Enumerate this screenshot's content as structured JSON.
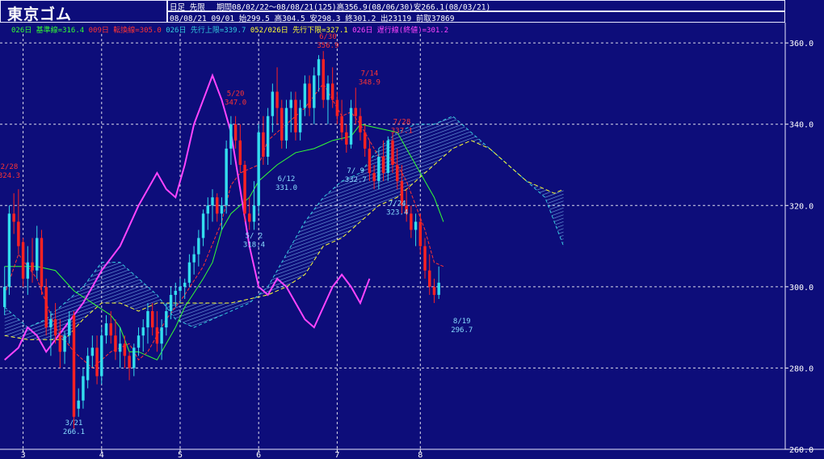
{
  "header": {
    "title": "東京ゴム",
    "line1_a": "日足 先限",
    "line1_b": "期間08/02/22～08/08/21(125)高356.9(08/06/30)安266.1(08/03/21)",
    "line2": "08/08/21 09/01 始299.5 高304.5 安298.3 終301.2 出23119 前取37869"
  },
  "legend": [
    {
      "text": "026日 基準線=316.4",
      "color": "#33ff33"
    },
    {
      "text": "009日 転換線=305.0",
      "color": "#ff3333"
    },
    {
      "text": "026日 先行上限=339.7",
      "color": "#33ccdd"
    },
    {
      "text": "052/026日 先行下限=327.1",
      "color": "#ffff33"
    },
    {
      "text": "026日 遅行線(終値)=301.2",
      "color": "#ff44ff"
    }
  ],
  "colors": {
    "background": "#0d0d7a",
    "grid": "#ffffff",
    "up_candle": "#33ddee",
    "down_candle": "#ff2222",
    "kijun": "#33ff33",
    "tenkan": "#ff3333",
    "senkou_a": "#33ccdd",
    "senkou_b": "#ffff33",
    "chikou": "#ff44ff",
    "axis_text": "#ffffff",
    "label_high": "#ff3333",
    "label_low": "#88ddff"
  },
  "chart_data": {
    "type": "candlestick",
    "ylim": [
      260,
      365
    ],
    "yticks": [
      260,
      280,
      300,
      320,
      340,
      360
    ],
    "ytick_labels": [
      "260.0",
      "280.0",
      "300.0",
      "320.0",
      "340.0",
      "360.0"
    ],
    "xlim": [
      0,
      170
    ],
    "month_ticks": [
      {
        "x": 5,
        "label": "3"
      },
      {
        "x": 22,
        "label": "4"
      },
      {
        "x": 39,
        "label": "5"
      },
      {
        "x": 56,
        "label": "6"
      },
      {
        "x": 73,
        "label": "7"
      },
      {
        "x": 91,
        "label": "8"
      }
    ],
    "candles": [
      [
        1,
        295,
        305,
        293,
        300
      ],
      [
        2,
        300,
        320,
        298,
        318
      ],
      [
        3,
        318,
        323,
        313,
        316
      ],
      [
        4,
        316,
        324,
        308,
        310
      ],
      [
        5,
        311,
        312,
        300,
        302
      ],
      [
        6,
        302,
        310,
        298,
        306
      ],
      [
        7,
        306,
        312,
        301,
        304
      ],
      [
        8,
        304,
        315,
        302,
        312
      ],
      [
        9,
        312,
        314,
        298,
        300
      ],
      [
        10,
        300,
        302,
        288,
        290
      ],
      [
        11,
        290,
        294,
        283,
        292
      ],
      [
        12,
        292,
        296,
        286,
        288
      ],
      [
        13,
        288,
        292,
        280,
        284
      ],
      [
        14,
        284,
        289,
        281,
        288
      ],
      [
        15,
        288,
        294,
        286,
        292
      ],
      [
        16,
        293,
        294,
        265,
        268
      ],
      [
        17,
        270,
        275,
        268,
        272
      ],
      [
        18,
        272,
        280,
        270,
        278
      ],
      [
        19,
        277,
        285,
        275,
        283
      ],
      [
        20,
        283,
        288,
        280,
        285
      ],
      [
        21,
        285,
        288,
        276,
        278
      ],
      [
        22,
        278,
        290,
        276,
        288
      ],
      [
        23,
        288,
        293,
        286,
        291
      ],
      [
        24,
        291,
        294,
        286,
        288
      ],
      [
        25,
        288,
        292,
        282,
        284
      ],
      [
        26,
        284,
        290,
        280,
        286
      ],
      [
        27,
        286,
        288,
        280,
        283
      ],
      [
        28,
        283,
        284,
        277,
        280
      ],
      [
        29,
        280,
        286,
        278,
        285
      ],
      [
        30,
        285,
        290,
        283,
        288
      ],
      [
        31,
        288,
        292,
        284,
        290
      ],
      [
        32,
        290,
        296,
        286,
        294
      ],
      [
        33,
        294,
        296,
        288,
        290
      ],
      [
        34,
        290,
        294,
        284,
        286
      ],
      [
        35,
        286,
        292,
        282,
        290
      ],
      [
        36,
        290,
        296,
        288,
        294
      ],
      [
        37,
        294,
        300,
        292,
        298
      ],
      [
        38,
        298,
        301,
        295,
        299
      ],
      [
        39,
        299,
        302,
        296,
        300
      ],
      [
        40,
        300,
        302,
        297,
        301
      ],
      [
        41,
        301,
        308,
        300,
        306
      ],
      [
        42,
        306,
        310,
        303,
        308
      ],
      [
        43,
        308,
        314,
        305,
        312
      ],
      [
        44,
        312,
        319,
        310,
        318
      ],
      [
        45,
        318,
        322,
        314,
        320
      ],
      [
        46,
        320,
        324,
        316,
        322
      ],
      [
        47,
        322,
        323,
        316,
        318
      ],
      [
        48,
        318,
        322,
        314,
        320
      ],
      [
        49,
        320,
        336,
        318,
        334
      ],
      [
        50,
        334,
        342,
        330,
        340
      ],
      [
        51,
        340,
        342,
        334,
        336
      ],
      [
        52,
        336,
        340,
        328,
        330
      ],
      [
        53,
        330,
        331,
        316,
        318
      ],
      [
        54,
        318,
        322,
        314,
        316
      ],
      [
        55,
        316,
        326,
        314,
        320
      ],
      [
        56,
        320,
        340,
        318,
        338
      ],
      [
        57,
        338,
        342,
        330,
        332
      ],
      [
        58,
        332,
        344,
        330,
        342
      ],
      [
        59,
        342,
        350,
        338,
        348
      ],
      [
        60,
        348,
        354,
        340,
        344
      ],
      [
        61,
        344,
        346,
        334,
        336
      ],
      [
        62,
        336,
        346,
        334,
        344
      ],
      [
        63,
        344,
        348,
        338,
        346
      ],
      [
        64,
        346,
        348,
        336,
        338
      ],
      [
        65,
        338,
        346,
        336,
        344
      ],
      [
        66,
        344,
        352,
        342,
        350
      ],
      [
        67,
        350,
        352,
        342,
        344
      ],
      [
        68,
        344,
        354,
        340,
        352
      ],
      [
        69,
        352,
        357,
        348,
        356
      ],
      [
        70,
        356,
        358,
        344,
        346
      ],
      [
        71,
        346,
        352,
        340,
        350
      ],
      [
        72,
        350,
        354,
        344,
        346
      ],
      [
        73,
        346,
        348,
        340,
        342
      ],
      [
        74,
        342,
        346,
        336,
        338
      ],
      [
        75,
        338,
        340,
        333,
        335
      ],
      [
        76,
        335,
        346,
        334,
        344
      ],
      [
        77,
        344,
        349,
        340,
        342
      ],
      [
        78,
        342,
        344,
        336,
        338
      ],
      [
        79,
        338,
        340,
        332,
        334
      ],
      [
        80,
        334,
        336,
        326,
        328
      ],
      [
        81,
        328,
        330,
        324,
        326
      ],
      [
        82,
        326,
        334,
        324,
        332
      ],
      [
        83,
        332,
        336,
        326,
        328
      ],
      [
        84,
        328,
        337,
        326,
        336
      ],
      [
        85,
        336,
        338,
        328,
        330
      ],
      [
        86,
        330,
        334,
        324,
        326
      ],
      [
        87,
        326,
        330,
        318,
        320
      ],
      [
        88,
        320,
        324,
        316,
        318
      ],
      [
        89,
        318,
        320,
        312,
        314
      ],
      [
        90,
        314,
        318,
        310,
        316
      ],
      [
        91,
        316,
        318,
        308,
        310
      ],
      [
        92,
        310,
        312,
        302,
        304
      ],
      [
        93,
        304,
        308,
        298,
        300
      ],
      [
        94,
        300,
        302,
        296,
        298
      ],
      [
        95,
        298,
        305,
        297,
        301
      ]
    ],
    "kijun": [
      [
        1,
        305
      ],
      [
        8,
        305
      ],
      [
        12,
        304
      ],
      [
        16,
        299
      ],
      [
        20,
        296
      ],
      [
        24,
        293
      ],
      [
        26,
        290
      ],
      [
        28,
        284
      ],
      [
        30,
        284
      ],
      [
        34,
        282
      ],
      [
        38,
        290
      ],
      [
        40,
        295
      ],
      [
        44,
        302
      ],
      [
        46,
        306
      ],
      [
        48,
        314
      ],
      [
        50,
        318
      ],
      [
        54,
        322
      ],
      [
        56,
        326
      ],
      [
        60,
        330
      ],
      [
        64,
        333
      ],
      [
        68,
        334
      ],
      [
        70,
        335
      ],
      [
        72,
        336
      ],
      [
        76,
        337
      ],
      [
        78,
        340
      ],
      [
        82,
        339
      ],
      [
        86,
        338
      ],
      [
        88,
        334
      ],
      [
        90,
        330
      ],
      [
        92,
        326
      ],
      [
        94,
        322
      ],
      [
        96,
        316
      ]
    ],
    "tenkan": [
      [
        1,
        298
      ],
      [
        4,
        308
      ],
      [
        8,
        302
      ],
      [
        12,
        290
      ],
      [
        16,
        284
      ],
      [
        20,
        280
      ],
      [
        24,
        284
      ],
      [
        28,
        286
      ],
      [
        30,
        282
      ],
      [
        32,
        284
      ],
      [
        36,
        292
      ],
      [
        40,
        298
      ],
      [
        44,
        305
      ],
      [
        48,
        316
      ],
      [
        50,
        325
      ],
      [
        52,
        328
      ],
      [
        56,
        330
      ],
      [
        58,
        336
      ],
      [
        62,
        340
      ],
      [
        66,
        344
      ],
      [
        70,
        350
      ],
      [
        72,
        346
      ],
      [
        74,
        342
      ],
      [
        76,
        343
      ],
      [
        78,
        340
      ],
      [
        80,
        336
      ],
      [
        82,
        332
      ],
      [
        84,
        332
      ],
      [
        86,
        330
      ],
      [
        88,
        326
      ],
      [
        90,
        320
      ],
      [
        92,
        314
      ],
      [
        94,
        306
      ],
      [
        96,
        305
      ]
    ],
    "senkou_a": [
      [
        1,
        295
      ],
      [
        6,
        290
      ],
      [
        10,
        292
      ],
      [
        14,
        296
      ],
      [
        18,
        300
      ],
      [
        22,
        306
      ],
      [
        26,
        306
      ],
      [
        30,
        302
      ],
      [
        34,
        298
      ],
      [
        38,
        292
      ],
      [
        42,
        290
      ],
      [
        46,
        292
      ],
      [
        50,
        294
      ],
      [
        54,
        296
      ],
      [
        58,
        300
      ],
      [
        62,
        308
      ],
      [
        66,
        316
      ],
      [
        70,
        322
      ],
      [
        74,
        326
      ],
      [
        78,
        328
      ],
      [
        82,
        334
      ],
      [
        86,
        338
      ],
      [
        90,
        340
      ],
      [
        94,
        340
      ],
      [
        98,
        342
      ],
      [
        102,
        338
      ],
      [
        106,
        334
      ],
      [
        110,
        330
      ],
      [
        114,
        326
      ],
      [
        118,
        322
      ],
      [
        120,
        316
      ],
      [
        122,
        310
      ]
    ],
    "senkou_b": [
      [
        1,
        288
      ],
      [
        6,
        287
      ],
      [
        10,
        287
      ],
      [
        14,
        287
      ],
      [
        18,
        292
      ],
      [
        22,
        296
      ],
      [
        26,
        296
      ],
      [
        30,
        294
      ],
      [
        34,
        296
      ],
      [
        38,
        296
      ],
      [
        42,
        296
      ],
      [
        46,
        296
      ],
      [
        50,
        296
      ],
      [
        54,
        297
      ],
      [
        58,
        298
      ],
      [
        62,
        300
      ],
      [
        66,
        303
      ],
      [
        70,
        310
      ],
      [
        74,
        312
      ],
      [
        78,
        316
      ],
      [
        82,
        320
      ],
      [
        86,
        322
      ],
      [
        90,
        326
      ],
      [
        94,
        330
      ],
      [
        98,
        334
      ],
      [
        102,
        336
      ],
      [
        106,
        334
      ],
      [
        110,
        330
      ],
      [
        114,
        326
      ],
      [
        118,
        324
      ],
      [
        120,
        323
      ],
      [
        122,
        324
      ]
    ],
    "chikou": [
      [
        1,
        282
      ],
      [
        4,
        285
      ],
      [
        6,
        290
      ],
      [
        8,
        288
      ],
      [
        10,
        284
      ],
      [
        14,
        290
      ],
      [
        18,
        296
      ],
      [
        22,
        304
      ],
      [
        26,
        310
      ],
      [
        30,
        320
      ],
      [
        34,
        328
      ],
      [
        36,
        324
      ],
      [
        38,
        322
      ],
      [
        40,
        330
      ],
      [
        42,
        340
      ],
      [
        44,
        346
      ],
      [
        46,
        352
      ],
      [
        48,
        346
      ],
      [
        50,
        338
      ],
      [
        52,
        324
      ],
      [
        54,
        310
      ],
      [
        56,
        300
      ],
      [
        58,
        298
      ],
      [
        60,
        302
      ],
      [
        62,
        300
      ],
      [
        64,
        296
      ],
      [
        66,
        292
      ],
      [
        68,
        290
      ],
      [
        70,
        295
      ],
      [
        72,
        300
      ],
      [
        74,
        303
      ],
      [
        76,
        300
      ],
      [
        78,
        296
      ],
      [
        80,
        302
      ]
    ],
    "annotations": [
      {
        "x": 2,
        "y": 329,
        "date": "2/28",
        "value": "324.3",
        "kind": "high"
      },
      {
        "x": 16,
        "y": 266,
        "date": "3/21",
        "value": "266.1",
        "kind": "low"
      },
      {
        "x": 55,
        "y": 312,
        "date": "5/ 2",
        "value": "318.4",
        "kind": "low"
      },
      {
        "x": 51,
        "y": 347,
        "date": "5/20",
        "value": "347.0",
        "kind": "high"
      },
      {
        "x": 62,
        "y": 326,
        "date": "6/12",
        "value": "331.0",
        "kind": "low"
      },
      {
        "x": 71,
        "y": 361,
        "date": "6/30",
        "value": "356.9",
        "kind": "high"
      },
      {
        "x": 77,
        "y": 328,
        "date": "7/ 9",
        "value": "332.7",
        "kind": "low"
      },
      {
        "x": 80,
        "y": 352,
        "date": "7/14",
        "value": "348.9",
        "kind": "high"
      },
      {
        "x": 87,
        "y": 340,
        "date": "7/28",
        "value": "337.1",
        "kind": "high"
      },
      {
        "x": 86,
        "y": 320,
        "date": "7/24",
        "value": "323.4",
        "kind": "low"
      },
      {
        "x": 100,
        "y": 291,
        "date": "8/19",
        "value": "296.7",
        "kind": "low"
      }
    ]
  }
}
